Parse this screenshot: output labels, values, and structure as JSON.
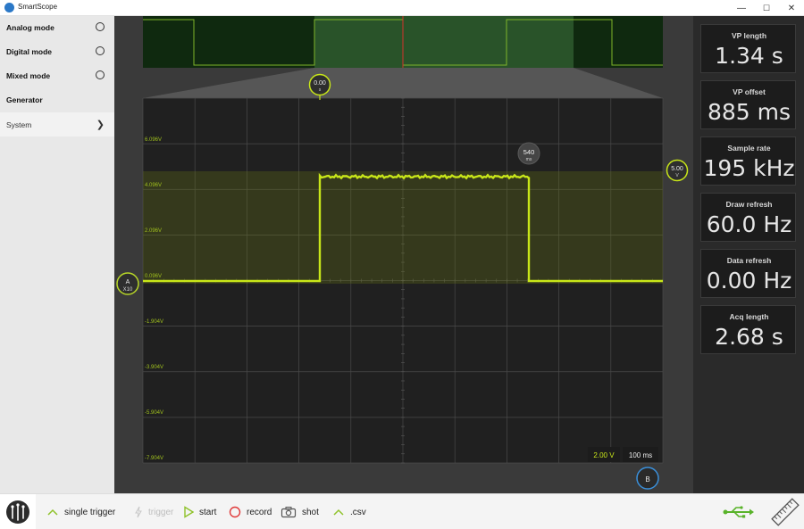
{
  "window": {
    "title": "SmartScope",
    "minimize": "—",
    "maximize": "☐",
    "close": "✕"
  },
  "sidebar": {
    "items": [
      {
        "label": "Analog mode",
        "selected": false
      },
      {
        "label": "Digital mode",
        "selected": false
      },
      {
        "label": "Mixed mode",
        "selected": false
      },
      {
        "label": "Generator"
      },
      {
        "label": "System"
      }
    ]
  },
  "scope": {
    "trigger_marker": {
      "value": "0.00",
      "unit": "s"
    },
    "cursor_marker": {
      "value": "540",
      "unit": "ms"
    },
    "trigger_level": {
      "value": "5.00",
      "unit": "V"
    },
    "channel_a": {
      "name": "A",
      "probe": "X10"
    },
    "channel_b": {
      "name": "B"
    },
    "voltage_grid_labels": [
      "6.096V",
      "4.096V",
      "2.096V",
      "0.096V",
      "-1.904V",
      "-3.904V",
      "-5.904V",
      "-7.904V"
    ],
    "volts_per_div": "2.00 V",
    "time_per_div": "100 ms",
    "colors": {
      "trace": "#c8e619",
      "channel_a": "#b7d628",
      "channel_b": "#3a8fd9",
      "grid": "#4a4a4a"
    }
  },
  "stats": [
    {
      "label": "VP length",
      "value": "1.34 s"
    },
    {
      "label": "VP offset",
      "value": "885 ms"
    },
    {
      "label": "Sample rate",
      "value": "195 kHz"
    },
    {
      "label": "Draw refresh",
      "value": "60.0 Hz"
    },
    {
      "label": "Data refresh",
      "value": "0.00 Hz"
    },
    {
      "label": "Acq length",
      "value": "2.68 s"
    }
  ],
  "toolbar": {
    "single_trigger": "single trigger",
    "trigger": "trigger",
    "start": "start",
    "record": "record",
    "shot": "shot",
    "csv": ".csv"
  },
  "icons": [
    "app-icon",
    "radio-icon",
    "chevron-right-icon",
    "chevron-up-icon",
    "bolt-icon",
    "play-icon",
    "record-circle-icon",
    "camera-icon",
    "usb-icon",
    "ruler-icon",
    "probe-logo-icon"
  ]
}
